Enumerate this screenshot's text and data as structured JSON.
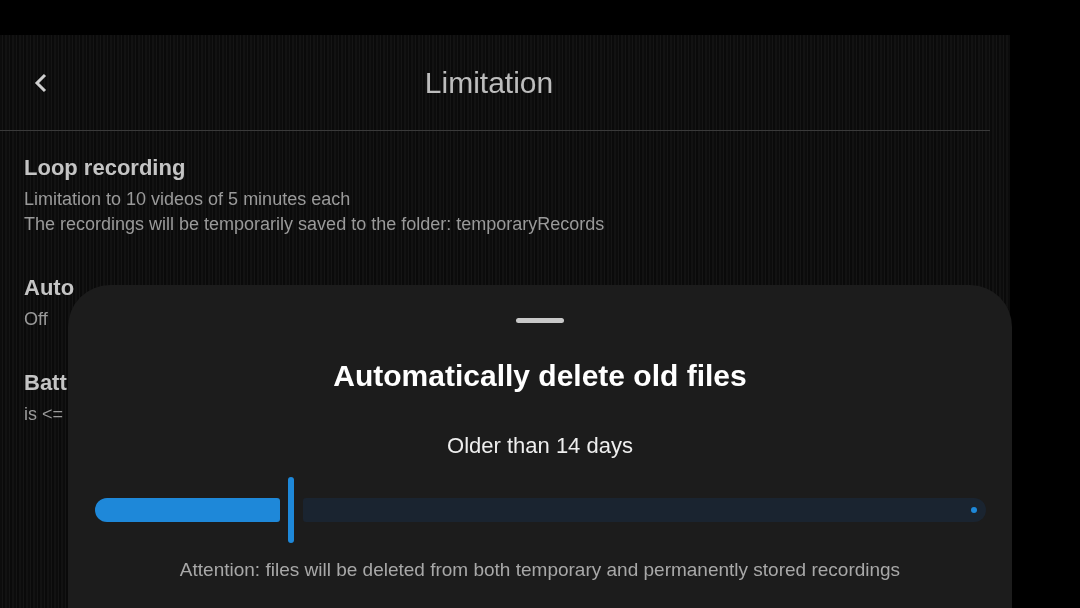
{
  "header": {
    "title": "Limitation"
  },
  "settings": [
    {
      "title": "Loop recording",
      "lines": [
        "Limitation to 10 videos of 5 minutes each",
        "The recordings will be temporarily saved to the folder: temporaryRecords"
      ]
    },
    {
      "title": "Auto",
      "lines": [
        "Off"
      ]
    },
    {
      "title": "Batt",
      "lines": [
        "is <="
      ]
    }
  ],
  "sheet": {
    "title": "Automatically delete old files",
    "value_label": "Older than 14 days",
    "slider": {
      "level": 0.22
    },
    "note": "Attention: files will be deleted from both temporary and permanently stored recordings"
  }
}
